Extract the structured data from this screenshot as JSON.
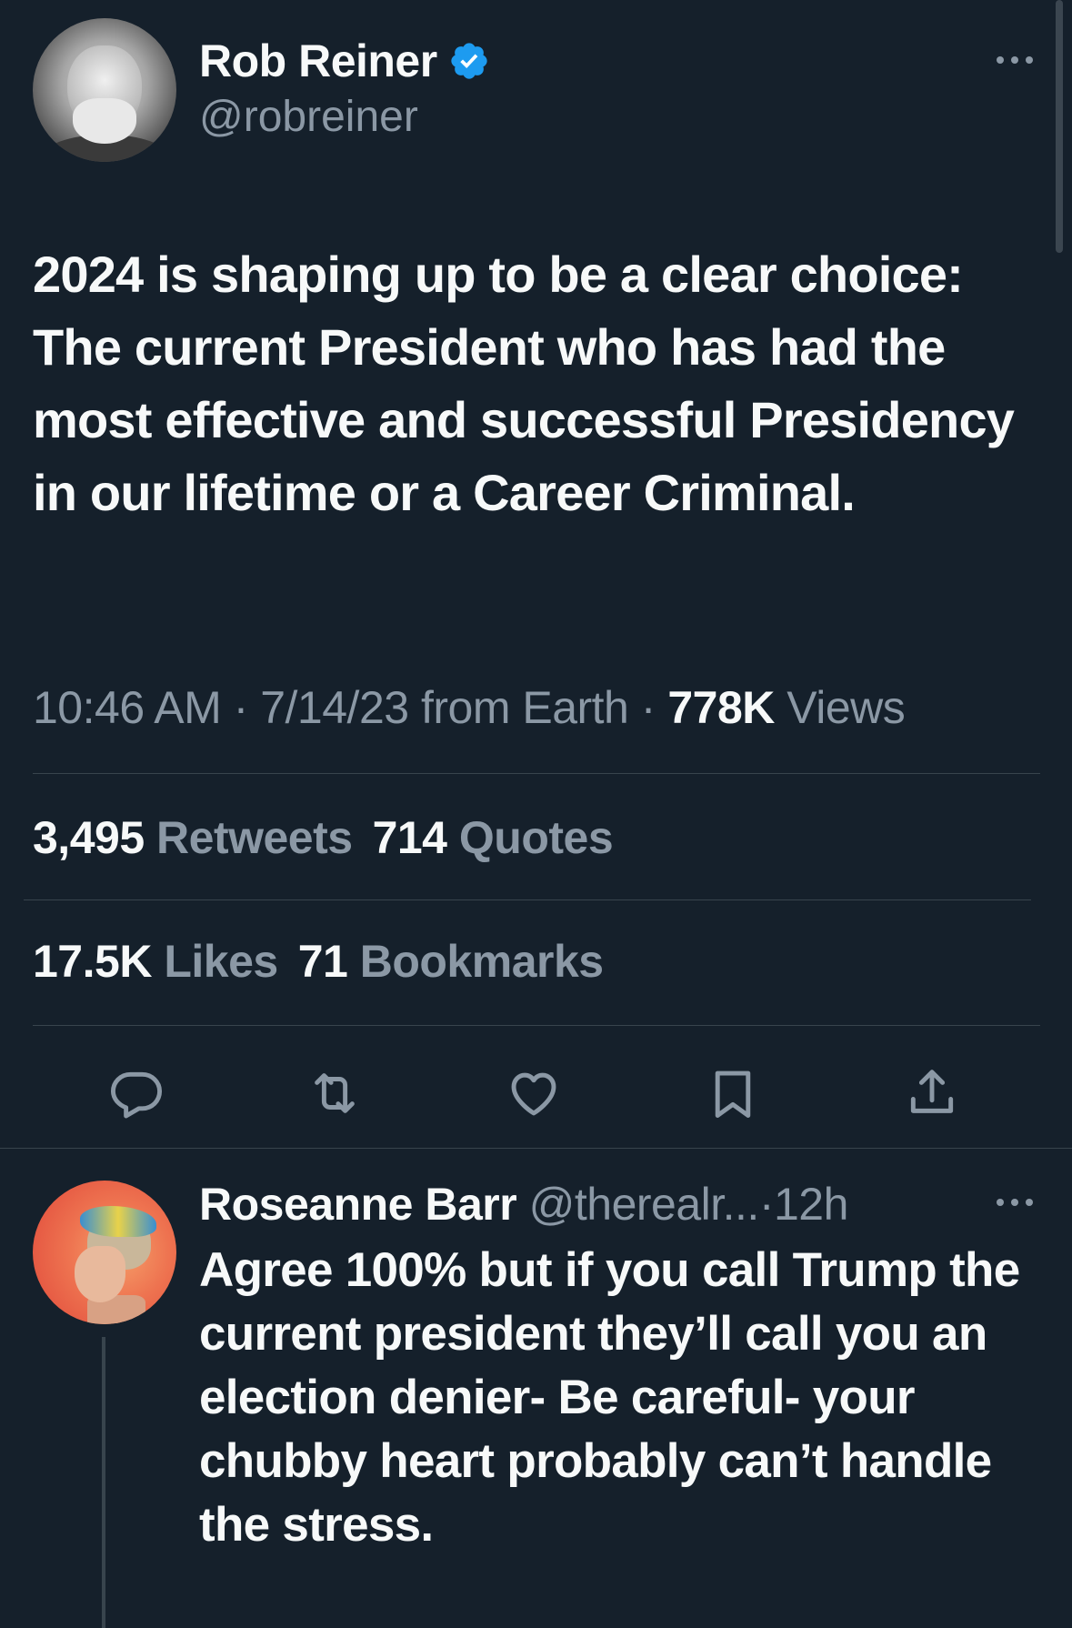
{
  "tweet": {
    "author_name": "Rob Reiner",
    "author_handle": "@robreiner",
    "avatar_icon": "profile-photo-rob-reiner",
    "verified_icon": "verified-badge-icon",
    "text": "2024 is shaping up to be a clear choice: The current President who has had the most effective and successful Presidency in our lifetime or a Career Criminal.",
    "time": "10:46 AM",
    "date": "7/14/23",
    "source": "from Earth",
    "views_count": "778K",
    "views_label": "Views",
    "separator": "·",
    "retweets_count": "3,495",
    "retweets_label": "Retweets",
    "quotes_count": "714",
    "quotes_label": "Quotes",
    "likes_count": "17.5K",
    "likes_label": "Likes",
    "bookmarks_count": "71",
    "bookmarks_label": "Bookmarks"
  },
  "actions": [
    {
      "name": "reply",
      "icon": "reply-icon"
    },
    {
      "name": "retweet",
      "icon": "retweet-icon"
    },
    {
      "name": "like",
      "icon": "heart-icon"
    },
    {
      "name": "bookmark",
      "icon": "bookmark-icon"
    },
    {
      "name": "share",
      "icon": "share-icon"
    }
  ],
  "reply": {
    "author_name": "Roseanne Barr",
    "author_handle": "@therealr...",
    "separator": "·",
    "time": "12h",
    "avatar_icon": "profile-photo-roseanne-barr",
    "text": "Agree 100% but if you call Trump the\ncurrent president they’ll call you an election denier- Be careful- your chubby heart probably can’t handle the stress."
  },
  "colors": {
    "background": "#15202b",
    "primary_text": "#f7f9f9",
    "secondary_text": "#8b98a5",
    "divider": "#38444d",
    "verified_blue": "#1d9bf0"
  }
}
